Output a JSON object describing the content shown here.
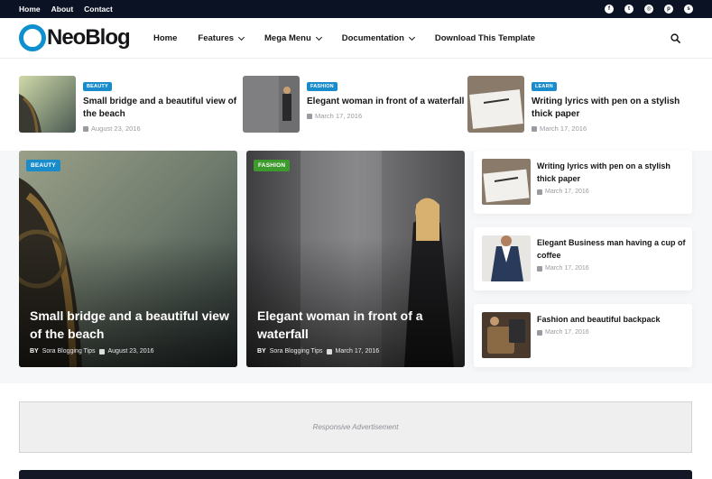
{
  "topbar": {
    "links": [
      "Home",
      "About",
      "Contact"
    ],
    "social": [
      {
        "icon": "facebook-icon",
        "glyph": "f"
      },
      {
        "icon": "twitter-icon",
        "glyph": "t"
      },
      {
        "icon": "instagram-icon",
        "glyph": "◎"
      },
      {
        "icon": "pinterest-icon",
        "glyph": "p"
      },
      {
        "icon": "skype-icon",
        "glyph": "s"
      }
    ]
  },
  "header": {
    "logo_text": "NeoBlog",
    "nav": {
      "home": "Home",
      "features": "Features",
      "mega_menu": "Mega Menu",
      "documentation": "Documentation",
      "download": "Download This Template"
    }
  },
  "ticker": [
    {
      "tag": "BEAUTY",
      "title": "Small bridge and a beautiful view of the beach",
      "date": "August 23, 2016"
    },
    {
      "tag": "FASHION",
      "title": "Elegant woman in front of a waterfall",
      "date": "March 17, 2016"
    },
    {
      "tag": "LEARN",
      "title": "Writing lyrics with pen on a stylish thick paper",
      "date": "March 17, 2016"
    }
  ],
  "featured": [
    {
      "tag": "BEAUTY",
      "title": "Small bridge and a beautiful view of the beach",
      "by": "BY",
      "author": "Sora Blogging Tips",
      "date": "August 23, 2016"
    },
    {
      "tag": "FASHION",
      "title": "Elegant woman in front of a waterfall",
      "by": "BY",
      "author": "Sora Blogging Tips",
      "date": "March 17, 2016"
    }
  ],
  "side_posts": [
    {
      "title": "Writing lyrics with pen on a stylish thick paper",
      "date": "March 17, 2016"
    },
    {
      "title": "Elegant Business man having a cup of coffee",
      "date": "March 17, 2016"
    },
    {
      "title": "Fashion and beautiful backpack",
      "date": "March 17, 2016"
    }
  ],
  "ad": {
    "label": "Responsive Advertisement"
  },
  "colors": {
    "topbar": "#0b1224",
    "accent_blue": "#0d8fd0",
    "badge_blue": "#1a8ccc",
    "badge_green": "#3d9a2c"
  }
}
